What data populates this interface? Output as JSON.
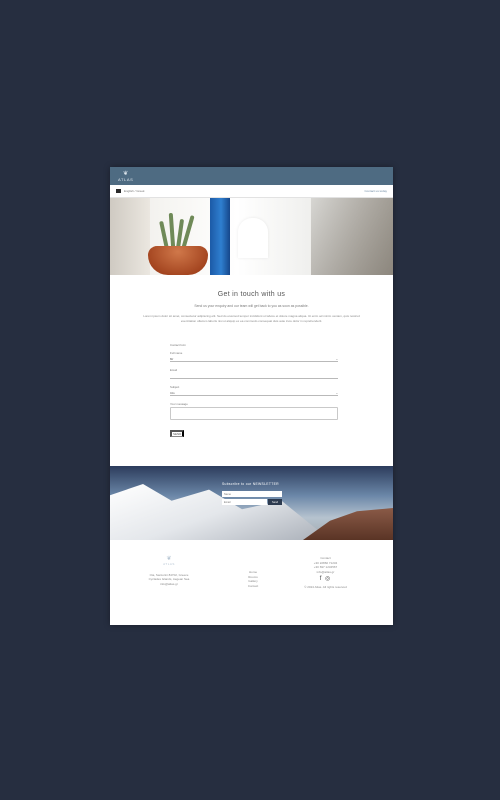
{
  "colors": {
    "background": "#262e40",
    "topbar": "#4e6b82",
    "link": "#6f8ba4",
    "button": "#2c3a4f"
  },
  "header": {
    "logo_mark": "❦",
    "logo_word": "ATLAS",
    "language": "English / Greek",
    "link_right": "Contact us today"
  },
  "main": {
    "title": "Get in touch with us",
    "subtitle": "Send us your enquiry and our team will get back to you as soon as possible.",
    "intro": "Lorem ipsum dolor sit amet, consectetur adipiscing elit. Sed do eiusmod tempor incididunt ut labore et dolore magna aliqua. Ut enim ad minim veniam, quis nostrud exercitation ullamco laboris nisi ut aliquip ex ea commodo consequat duis aute irure dolor in reprehenderit."
  },
  "form": {
    "heading": "Contact form",
    "name_label": "Full name",
    "name_value": "Mr",
    "email_label": "Email",
    "subject_label": "Subject",
    "subject_value": "Info",
    "message_label": "Your message",
    "submit_label": "SEND"
  },
  "newsletter": {
    "title": "Subscribe to our NEWSLETTER",
    "name_placeholder": "Name",
    "email_placeholder": "Email",
    "button_label": "Send"
  },
  "footer": {
    "logo_mark": "❦",
    "logo_word": "ATLAS",
    "address_1": "Oia, Santorini 84702, Greece",
    "address_2": "Cyclades Islands, Aegean Sea",
    "address_3": "info@atlas.gr",
    "links": [
      "Home",
      "Rooms",
      "Gallery",
      "Contact"
    ],
    "contact_title": "Contact",
    "phone_1": "+30 22860 71234",
    "phone_2": "+30 697 1234567",
    "email": "info@atlas.gr",
    "social": "f  ◎",
    "copyright": "© 2024 Atlas. All rights reserved"
  }
}
